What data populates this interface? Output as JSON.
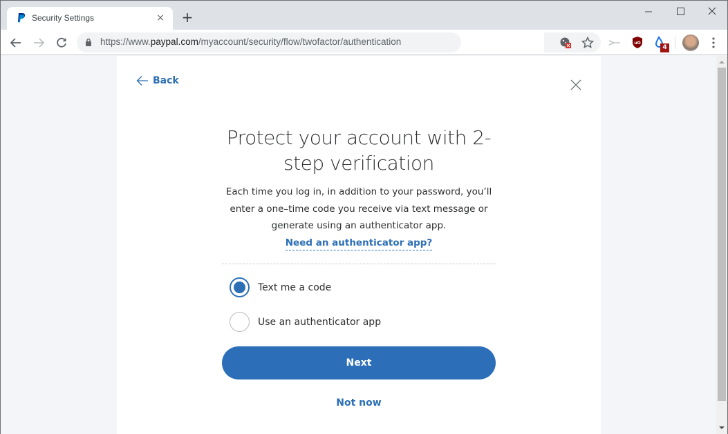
{
  "browser": {
    "tab": {
      "title": "Security Settings",
      "close_label": "×"
    },
    "new_tab_label": "+",
    "url": {
      "scheme_prefix": "https://www.",
      "host": "paypal.com",
      "path": "/myaccount/security/flow/twofactor/authentication"
    },
    "extension_badge_count": "4",
    "icons": [
      "back-arrow-icon",
      "forward-arrow-icon",
      "reload-icon",
      "lock-icon",
      "cookie-blocked-icon",
      "star-icon",
      "scissors-icon",
      "ublock-icon",
      "droplet-extension-icon",
      "profile-avatar",
      "menu-dots-icon"
    ]
  },
  "page": {
    "back_label": "Back",
    "headline_line1": "Protect your account with 2-",
    "headline_line2": "step verification",
    "description_lines": [
      "Each time you log in, in addition to your password, you’ll",
      "enter a one–time code you receive via text message or",
      "generate using an authenticator app."
    ],
    "auth_link": "Need an authenticator app?",
    "options": [
      {
        "label": "Text me a code",
        "selected": true
      },
      {
        "label": "Use an authenticator app",
        "selected": false
      }
    ],
    "next_button": "Next",
    "not_now": "Not now"
  },
  "colors": {
    "accent": "#2c6fb5",
    "button": "#2c6fb8",
    "page_bg": "#f4f5f9"
  }
}
